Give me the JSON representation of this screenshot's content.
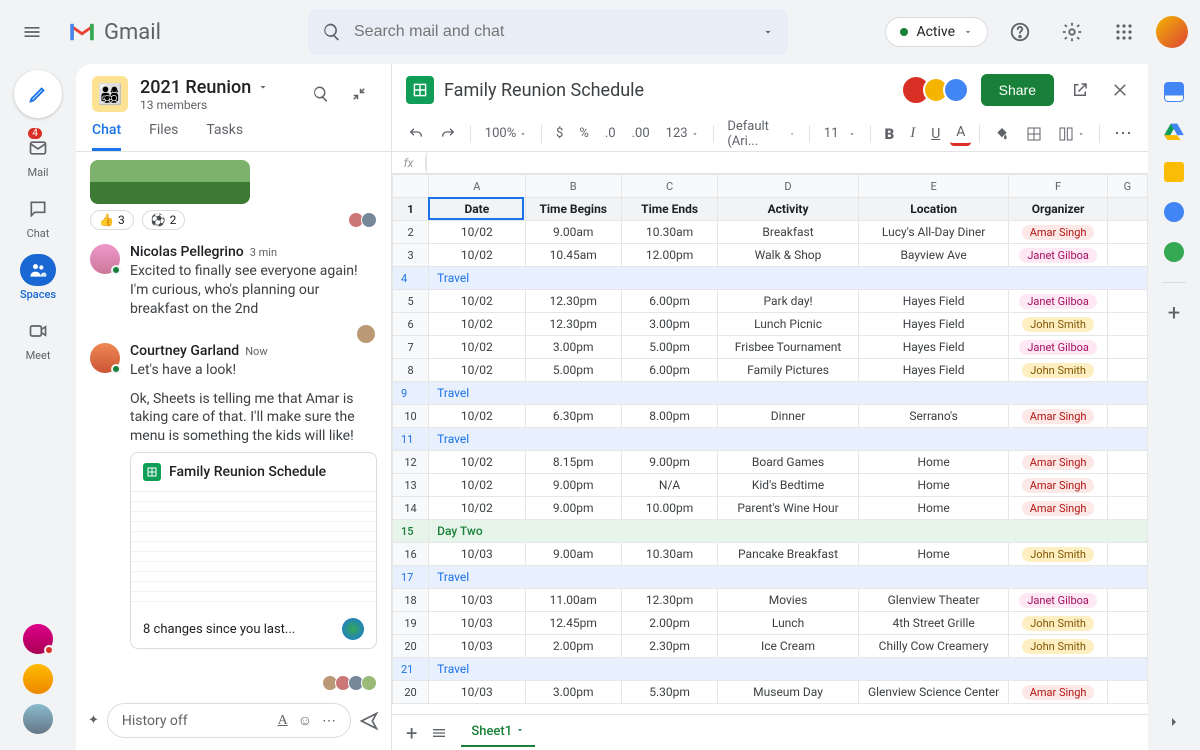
{
  "header": {
    "app": "Gmail",
    "search_placeholder": "Search mail and chat",
    "status": "Active"
  },
  "leftrail": {
    "items": [
      {
        "label": "Mail",
        "badge": "4"
      },
      {
        "label": "Chat"
      },
      {
        "label": "Spaces"
      },
      {
        "label": "Meet"
      }
    ]
  },
  "space": {
    "name": "2021 Reunion",
    "subtitle": "13 members",
    "tabs": [
      "Chat",
      "Files",
      "Tasks"
    ],
    "reactions": [
      {
        "emoji": "👍",
        "count": "3"
      },
      {
        "emoji": "⚽",
        "count": "2"
      }
    ],
    "messages": [
      {
        "author": "Nicolas Pellegrino",
        "time": "3 min",
        "text": "Excited to finally see everyone again! I'm curious, who's planning our breakfast on the 2nd"
      },
      {
        "author": "Courtney Garland",
        "time": "Now",
        "text1": "Let's have a look!",
        "text2": "Ok, Sheets is telling me that Amar is taking care of that. I'll make sure the menu is something the kids will like!"
      }
    ],
    "sheet_card": {
      "title": "Family Reunion Schedule",
      "footer": "8 changes since you last..."
    },
    "compose": {
      "placeholder": "History off"
    }
  },
  "sheet": {
    "title": "Family Reunion Schedule",
    "share": "Share",
    "toolbar": {
      "zoom": "100%",
      "font": "Default (Ari...",
      "size": "11",
      "numfmt": [
        ".0",
        ".00",
        "123"
      ]
    },
    "fx": "fx",
    "columns": [
      "A",
      "B",
      "C",
      "D",
      "E",
      "F",
      "G"
    ],
    "headers": [
      "Date",
      "Time Begins",
      "Time Ends",
      "Activity",
      "Location",
      "Organizer"
    ],
    "rows": [
      {
        "n": 2,
        "d": "10/02",
        "b": "9.00am",
        "e": "10.30am",
        "a": "Breakfast",
        "l": "Lucy's All-Day Diner",
        "o": "Amar Singh",
        "oc": "amar"
      },
      {
        "n": 3,
        "d": "10/02",
        "b": "10.45am",
        "e": "12.00pm",
        "a": "Walk & Shop",
        "l": "Bayview Ave",
        "o": "Janet Gilboa",
        "oc": "janet"
      },
      {
        "n": 4,
        "travel": true
      },
      {
        "n": 5,
        "d": "10/02",
        "b": "12.30pm",
        "e": "6.00pm",
        "a": "Park day!",
        "l": "Hayes Field",
        "o": "Janet Gilboa",
        "oc": "janet"
      },
      {
        "n": 6,
        "d": "10/02",
        "b": "12.30pm",
        "e": "3.00pm",
        "a": "Lunch Picnic",
        "l": "Hayes Field",
        "o": "John Smith",
        "oc": "john"
      },
      {
        "n": 7,
        "d": "10/02",
        "b": "3.00pm",
        "e": "5.00pm",
        "a": "Frisbee Tournament",
        "l": "Hayes Field",
        "o": "Janet Gilboa",
        "oc": "janet"
      },
      {
        "n": 8,
        "d": "10/02",
        "b": "5.00pm",
        "e": "6.00pm",
        "a": "Family Pictures",
        "l": "Hayes Field",
        "o": "John Smith",
        "oc": "john"
      },
      {
        "n": 9,
        "travel": true
      },
      {
        "n": 10,
        "d": "10/02",
        "b": "6.30pm",
        "e": "8.00pm",
        "a": "Dinner",
        "l": "Serrano's",
        "o": "Amar Singh",
        "oc": "amar"
      },
      {
        "n": 11,
        "travel": true
      },
      {
        "n": 12,
        "d": "10/02",
        "b": "8.15pm",
        "e": "9.00pm",
        "a": "Board Games",
        "l": "Home",
        "o": "Amar Singh",
        "oc": "amar"
      },
      {
        "n": 13,
        "d": "10/02",
        "b": "9.00pm",
        "e": "N/A",
        "a": "Kid's Bedtime",
        "l": "Home",
        "o": "Amar Singh",
        "oc": "amar"
      },
      {
        "n": 14,
        "d": "10/02",
        "b": "9.00pm",
        "e": "10.00pm",
        "a": "Parent's Wine Hour",
        "l": "Home",
        "o": "Amar Singh",
        "oc": "amar"
      },
      {
        "n": 15,
        "daytwo": true,
        "label": "Day Two"
      },
      {
        "n": 16,
        "d": "10/03",
        "b": "9.00am",
        "e": "10.30am",
        "a": "Pancake Breakfast",
        "l": "Home",
        "o": "John Smith",
        "oc": "john"
      },
      {
        "n": 17,
        "travel": true
      },
      {
        "n": 18,
        "d": "10/03",
        "b": "11.00am",
        "e": "12.30pm",
        "a": "Movies",
        "l": "Glenview Theater",
        "o": "Janet Gilboa",
        "oc": "janet"
      },
      {
        "n": 19,
        "d": "10/03",
        "b": "12.45pm",
        "e": "2.00pm",
        "a": "Lunch",
        "l": "4th Street Grille",
        "o": "John Smith",
        "oc": "john"
      },
      {
        "n": 20,
        "d": "10/03",
        "b": "2.00pm",
        "e": "2.30pm",
        "a": "Ice Cream",
        "l": "Chilly Cow Creamery",
        "o": "John Smith",
        "oc": "john"
      },
      {
        "n": 21,
        "travel": true
      },
      {
        "n": 20,
        "d": "10/03",
        "b": "3.00pm",
        "e": "5.30pm",
        "a": "Museum Day",
        "l": "Glenview Science Center",
        "o": "Amar Singh",
        "oc": "amar"
      }
    ],
    "travel_label": "Travel",
    "footer_tab": "Sheet1"
  }
}
